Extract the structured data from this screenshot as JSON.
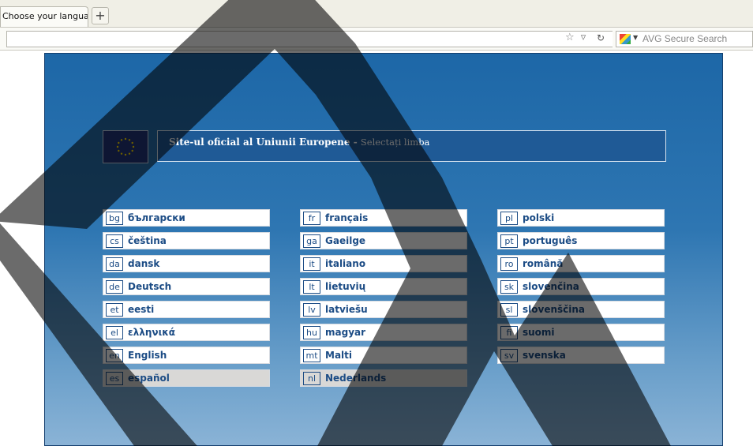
{
  "browser": {
    "tab_title": "Choose your langua...",
    "new_tab": "+",
    "search_placeholder": "AVG Secure Search"
  },
  "header": {
    "title_bold": "Site-ul oficial al Uniunii Europene",
    "separator": " - ",
    "subtitle": "Selectați limba"
  },
  "languages": {
    "col1": [
      {
        "code": "bg",
        "label": "български"
      },
      {
        "code": "cs",
        "label": "čeština"
      },
      {
        "code": "da",
        "label": "dansk"
      },
      {
        "code": "de",
        "label": "Deutsch"
      },
      {
        "code": "et",
        "label": "eesti"
      },
      {
        "code": "el",
        "label": "ελληνικά"
      },
      {
        "code": "en",
        "label": "English"
      },
      {
        "code": "es",
        "label": "español"
      }
    ],
    "col2": [
      {
        "code": "fr",
        "label": "français"
      },
      {
        "code": "ga",
        "label": "Gaeilge"
      },
      {
        "code": "it",
        "label": "italiano"
      },
      {
        "code": "lt",
        "label": "lietuvių"
      },
      {
        "code": "lv",
        "label": "latviešu"
      },
      {
        "code": "hu",
        "label": "magyar"
      },
      {
        "code": "mt",
        "label": "Malti"
      },
      {
        "code": "nl",
        "label": "Nederlands"
      }
    ],
    "col3": [
      {
        "code": "pl",
        "label": "polski"
      },
      {
        "code": "pt",
        "label": "português"
      },
      {
        "code": "ro",
        "label": "română"
      },
      {
        "code": "sk",
        "label": "slovenčina"
      },
      {
        "code": "sl",
        "label": "slovenščina"
      },
      {
        "code": "fi",
        "label": "suomi"
      },
      {
        "code": "sv",
        "label": "svenska"
      }
    ]
  },
  "colors": {
    "page_top": "#1d67a7",
    "link": "#1c4c85"
  }
}
